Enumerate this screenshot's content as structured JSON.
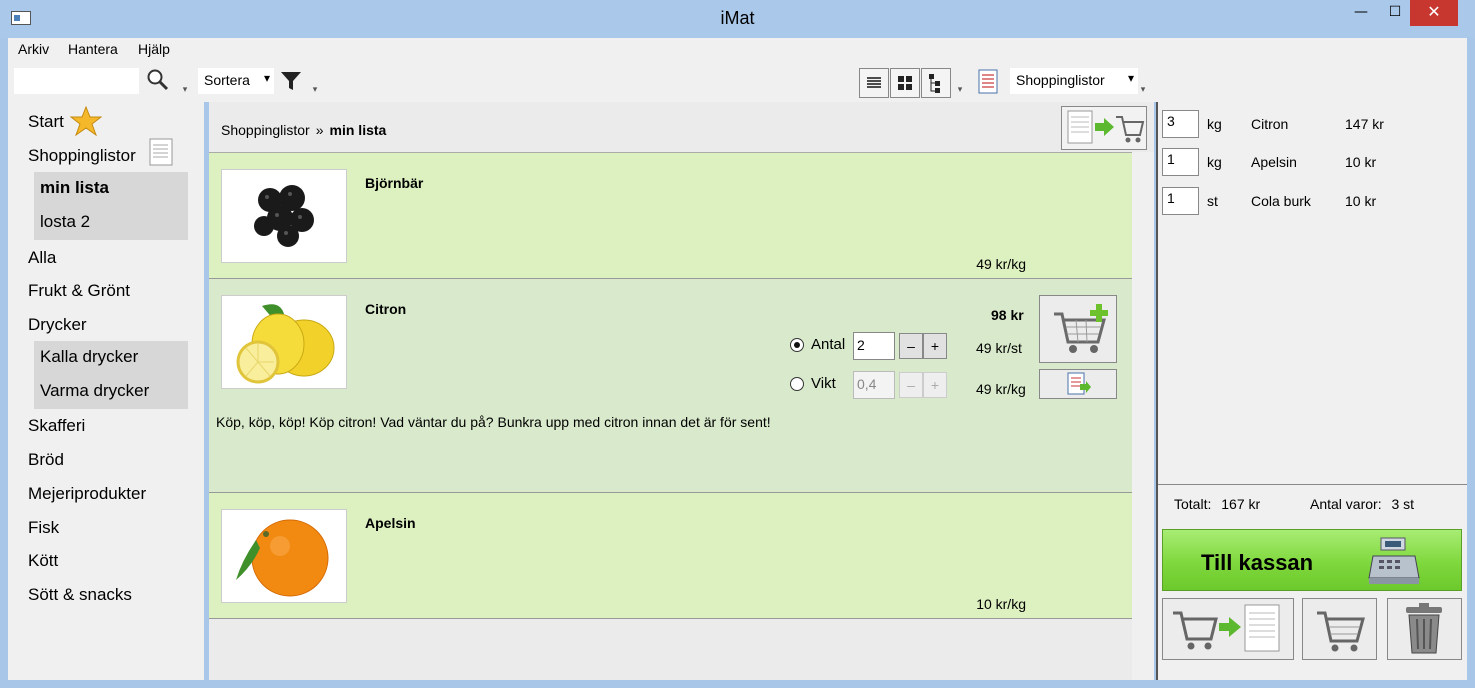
{
  "window": {
    "title": "iMat",
    "min_glyph": "—",
    "max_glyph": "☐",
    "close_glyph": "✕"
  },
  "menu": {
    "items": [
      "Arkiv",
      "Hantera",
      "Hjälp"
    ]
  },
  "toolbar": {
    "search_placeholder": "",
    "sort_label": "Sortera",
    "shop_label": "Shoppinglistor",
    "dropdown_glyph": "▾"
  },
  "sidebar": {
    "start": "Start",
    "shoppinglistor": "Shoppinglistor",
    "lists": [
      "min lista",
      "losta 2"
    ],
    "alla": "Alla",
    "frukt": "Frukt & Grönt",
    "drycker": "Drycker",
    "drink_subs": [
      "Kalla drycker",
      "Varma drycker"
    ],
    "categories": [
      "Skafferi",
      "Bröd",
      "Mejeriprodukter",
      "Fisk",
      "Kött",
      "Sött & snacks"
    ]
  },
  "main": {
    "breadcrumb": {
      "parent": "Shoppinglistor",
      "separator": "»",
      "current": "min lista"
    },
    "products": [
      {
        "name": "Björnbär",
        "price": "49 kr/kg"
      },
      {
        "name": "Citron",
        "total": "98 kr",
        "antal_label": "Antal",
        "antal_value": "2",
        "antal_price": "49 kr/st",
        "vikt_label": "Vikt",
        "vikt_value": "0,4",
        "vikt_price": "49 kr/kg",
        "minus": "–",
        "plus": "+",
        "selected_mode": "antal",
        "description": "Köp, köp, köp! Köp citron! Vad väntar du på? Bunkra upp med citron innan det är för sent!"
      },
      {
        "name": "Apelsin",
        "price": "10 kr/kg"
      }
    ]
  },
  "cart": {
    "items": [
      {
        "qty": "3",
        "unit": "kg",
        "name": "Citron",
        "price": "147 kr"
      },
      {
        "qty": "1",
        "unit": "kg",
        "name": "Apelsin",
        "price": "10 kr"
      },
      {
        "qty": "1",
        "unit": "st",
        "name": "Cola burk",
        "price": "10 kr"
      }
    ],
    "total_label": "Totalt:",
    "total_value": "167 kr",
    "count_label": "Antal varor:",
    "count_value": "3 st",
    "checkout_label": "Till kassan"
  },
  "colors": {
    "title_bar": "#aac8ea",
    "close_button": "#c7372f",
    "product_row": "#dcf0c0",
    "selected_product_row": "#d9eacc",
    "checkout_green": "#7fd83d"
  }
}
